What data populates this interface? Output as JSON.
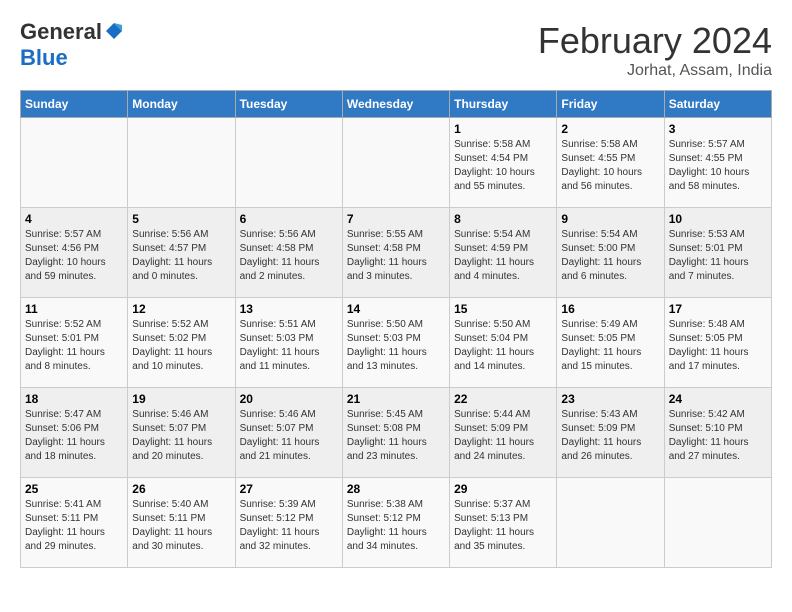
{
  "header": {
    "logo_line1": "General",
    "logo_line2": "Blue",
    "month": "February 2024",
    "location": "Jorhat, Assam, India"
  },
  "days_of_week": [
    "Sunday",
    "Monday",
    "Tuesday",
    "Wednesday",
    "Thursday",
    "Friday",
    "Saturday"
  ],
  "weeks": [
    [
      {
        "day": "",
        "info": ""
      },
      {
        "day": "",
        "info": ""
      },
      {
        "day": "",
        "info": ""
      },
      {
        "day": "",
        "info": ""
      },
      {
        "day": "1",
        "info": "Sunrise: 5:58 AM\nSunset: 4:54 PM\nDaylight: 10 hours and 55 minutes."
      },
      {
        "day": "2",
        "info": "Sunrise: 5:58 AM\nSunset: 4:55 PM\nDaylight: 10 hours and 56 minutes."
      },
      {
        "day": "3",
        "info": "Sunrise: 5:57 AM\nSunset: 4:55 PM\nDaylight: 10 hours and 58 minutes."
      }
    ],
    [
      {
        "day": "4",
        "info": "Sunrise: 5:57 AM\nSunset: 4:56 PM\nDaylight: 10 hours and 59 minutes."
      },
      {
        "day": "5",
        "info": "Sunrise: 5:56 AM\nSunset: 4:57 PM\nDaylight: 11 hours and 0 minutes."
      },
      {
        "day": "6",
        "info": "Sunrise: 5:56 AM\nSunset: 4:58 PM\nDaylight: 11 hours and 2 minutes."
      },
      {
        "day": "7",
        "info": "Sunrise: 5:55 AM\nSunset: 4:58 PM\nDaylight: 11 hours and 3 minutes."
      },
      {
        "day": "8",
        "info": "Sunrise: 5:54 AM\nSunset: 4:59 PM\nDaylight: 11 hours and 4 minutes."
      },
      {
        "day": "9",
        "info": "Sunrise: 5:54 AM\nSunset: 5:00 PM\nDaylight: 11 hours and 6 minutes."
      },
      {
        "day": "10",
        "info": "Sunrise: 5:53 AM\nSunset: 5:01 PM\nDaylight: 11 hours and 7 minutes."
      }
    ],
    [
      {
        "day": "11",
        "info": "Sunrise: 5:52 AM\nSunset: 5:01 PM\nDaylight: 11 hours and 8 minutes."
      },
      {
        "day": "12",
        "info": "Sunrise: 5:52 AM\nSunset: 5:02 PM\nDaylight: 11 hours and 10 minutes."
      },
      {
        "day": "13",
        "info": "Sunrise: 5:51 AM\nSunset: 5:03 PM\nDaylight: 11 hours and 11 minutes."
      },
      {
        "day": "14",
        "info": "Sunrise: 5:50 AM\nSunset: 5:03 PM\nDaylight: 11 hours and 13 minutes."
      },
      {
        "day": "15",
        "info": "Sunrise: 5:50 AM\nSunset: 5:04 PM\nDaylight: 11 hours and 14 minutes."
      },
      {
        "day": "16",
        "info": "Sunrise: 5:49 AM\nSunset: 5:05 PM\nDaylight: 11 hours and 15 minutes."
      },
      {
        "day": "17",
        "info": "Sunrise: 5:48 AM\nSunset: 5:05 PM\nDaylight: 11 hours and 17 minutes."
      }
    ],
    [
      {
        "day": "18",
        "info": "Sunrise: 5:47 AM\nSunset: 5:06 PM\nDaylight: 11 hours and 18 minutes."
      },
      {
        "day": "19",
        "info": "Sunrise: 5:46 AM\nSunset: 5:07 PM\nDaylight: 11 hours and 20 minutes."
      },
      {
        "day": "20",
        "info": "Sunrise: 5:46 AM\nSunset: 5:07 PM\nDaylight: 11 hours and 21 minutes."
      },
      {
        "day": "21",
        "info": "Sunrise: 5:45 AM\nSunset: 5:08 PM\nDaylight: 11 hours and 23 minutes."
      },
      {
        "day": "22",
        "info": "Sunrise: 5:44 AM\nSunset: 5:09 PM\nDaylight: 11 hours and 24 minutes."
      },
      {
        "day": "23",
        "info": "Sunrise: 5:43 AM\nSunset: 5:09 PM\nDaylight: 11 hours and 26 minutes."
      },
      {
        "day": "24",
        "info": "Sunrise: 5:42 AM\nSunset: 5:10 PM\nDaylight: 11 hours and 27 minutes."
      }
    ],
    [
      {
        "day": "25",
        "info": "Sunrise: 5:41 AM\nSunset: 5:11 PM\nDaylight: 11 hours and 29 minutes."
      },
      {
        "day": "26",
        "info": "Sunrise: 5:40 AM\nSunset: 5:11 PM\nDaylight: 11 hours and 30 minutes."
      },
      {
        "day": "27",
        "info": "Sunrise: 5:39 AM\nSunset: 5:12 PM\nDaylight: 11 hours and 32 minutes."
      },
      {
        "day": "28",
        "info": "Sunrise: 5:38 AM\nSunset: 5:12 PM\nDaylight: 11 hours and 34 minutes."
      },
      {
        "day": "29",
        "info": "Sunrise: 5:37 AM\nSunset: 5:13 PM\nDaylight: 11 hours and 35 minutes."
      },
      {
        "day": "",
        "info": ""
      },
      {
        "day": "",
        "info": ""
      }
    ]
  ]
}
